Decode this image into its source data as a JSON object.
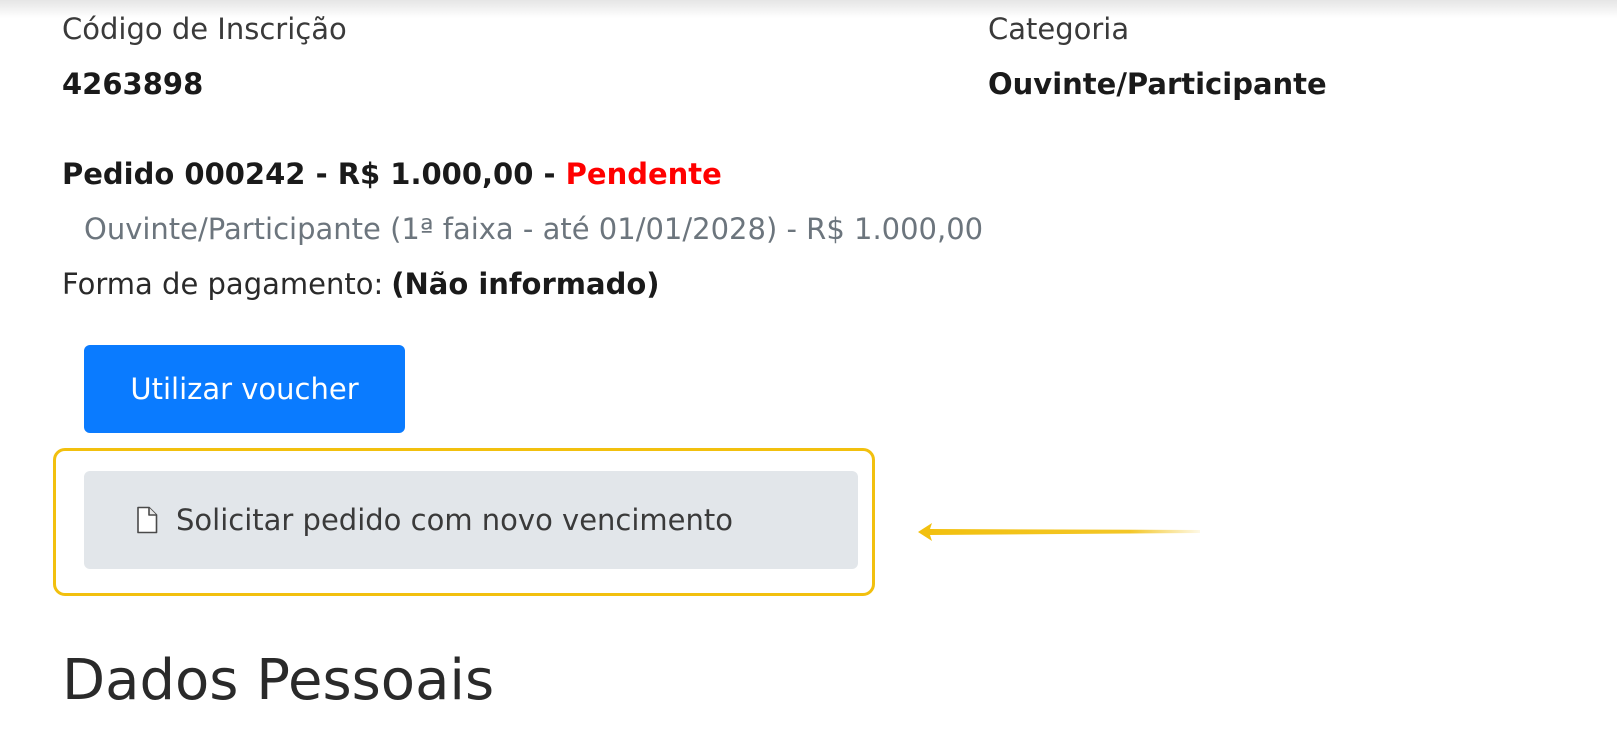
{
  "registration": {
    "code_label": "Código de Inscrição",
    "code_value": "4263898",
    "category_label": "Categoria",
    "category_value": "Ouvinte/Participante"
  },
  "order": {
    "summary": "Pedido 000242 - R$ 1.000,00 - ",
    "status": "Pendente",
    "status_color": "#ff0000",
    "item": "Ouvinte/Participante (1ª faixa - até 01/01/2028) - R$ 1.000,00",
    "payment_label": "Forma de pagamento:",
    "payment_value": "(Não informado)"
  },
  "actions": {
    "voucher_label": "Utilizar voucher",
    "voucher_color": "#0a7bff",
    "new_due_label": "Solicitar pedido com novo vencimento",
    "new_due_icon": "document-icon"
  },
  "annotation": {
    "highlight_color": "#f2c00e",
    "arrow_icon": "arrow-left-icon"
  },
  "personal": {
    "title": "Dados Pessoais"
  }
}
